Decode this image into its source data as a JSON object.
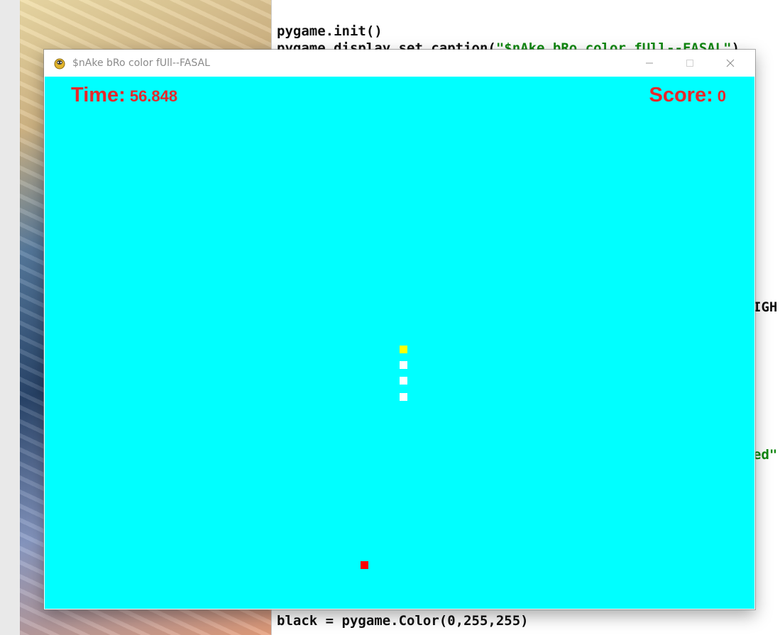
{
  "window": {
    "title": "$nAke bRo color fUll--FASAL",
    "icon": "pygame-snake-icon"
  },
  "hud": {
    "time_label": "Time:",
    "time_value": "56.848",
    "score_label": "Score:",
    "score_value": "0"
  },
  "game": {
    "background_color": "#00ffff",
    "snake_head_color": "#ffff00",
    "snake_body_color": "#ffffff",
    "food_color": "#ff0000",
    "snake_length": 4
  },
  "editor": {
    "line_init": "pygame.init()",
    "line_caption_code": "pygame.display.set_caption(",
    "line_caption_str": "\"$nAke bRo color fUll--FASAL\"",
    "line_caption_end": ")",
    "fragment_igh": "IGH",
    "fragment_ed": "ed\"",
    "line_black": "black = pygame.Color(0,255,255)"
  }
}
